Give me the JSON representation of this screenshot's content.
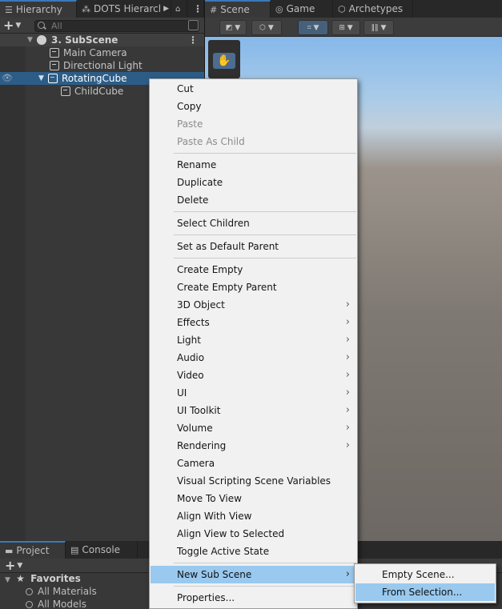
{
  "hierarchy": {
    "tabs": [
      {
        "label": "Hierarchy",
        "icon": "list-icon"
      },
      {
        "label": "DOTS Hierarcl",
        "icon": "dots-icon"
      }
    ],
    "search_placeholder": "All",
    "scene_name": "3. SubScene",
    "items": [
      {
        "label": "Main Camera"
      },
      {
        "label": "Directional Light"
      },
      {
        "label": "RotatingCube",
        "selected": true
      },
      {
        "label": "ChildCube"
      }
    ]
  },
  "scene": {
    "tabs": [
      {
        "label": "Scene"
      },
      {
        "label": "Game"
      },
      {
        "label": "Archetypes"
      }
    ]
  },
  "project": {
    "tabs": [
      {
        "label": "Project"
      },
      {
        "label": "Console"
      }
    ],
    "favorites_label": "Favorites",
    "favorites": [
      {
        "label": "All Materials"
      },
      {
        "label": "All Models"
      }
    ]
  },
  "context_menu": {
    "items": [
      {
        "label": "Cut"
      },
      {
        "label": "Copy"
      },
      {
        "label": "Paste",
        "disabled": true
      },
      {
        "label": "Paste As Child",
        "disabled": true
      },
      {
        "label": "Rename"
      },
      {
        "label": "Duplicate"
      },
      {
        "label": "Delete"
      },
      {
        "label": "Select Children"
      },
      {
        "label": "Set as Default Parent"
      },
      {
        "label": "Create Empty"
      },
      {
        "label": "Create Empty Parent"
      },
      {
        "label": "3D Object",
        "submenu": true
      },
      {
        "label": "Effects",
        "submenu": true
      },
      {
        "label": "Light",
        "submenu": true
      },
      {
        "label": "Audio",
        "submenu": true
      },
      {
        "label": "Video",
        "submenu": true
      },
      {
        "label": "UI",
        "submenu": true
      },
      {
        "label": "UI Toolkit",
        "submenu": true
      },
      {
        "label": "Volume",
        "submenu": true
      },
      {
        "label": "Rendering",
        "submenu": true
      },
      {
        "label": "Camera"
      },
      {
        "label": "Visual Scripting Scene Variables"
      },
      {
        "label": "Move To View"
      },
      {
        "label": "Align With View"
      },
      {
        "label": "Align View to Selected"
      },
      {
        "label": "Toggle Active State"
      },
      {
        "label": "New Sub Scene",
        "submenu": true,
        "highlighted": true
      },
      {
        "label": "Properties..."
      }
    ]
  },
  "submenu": {
    "items": [
      {
        "label": "Empty Scene..."
      },
      {
        "label": "From Selection...",
        "highlighted": true
      }
    ]
  },
  "colors": {
    "selection": "#2c5d87",
    "menu_highlight": "#99c9ef",
    "menu_background": "#f1f1f1",
    "panel": "#383838"
  }
}
